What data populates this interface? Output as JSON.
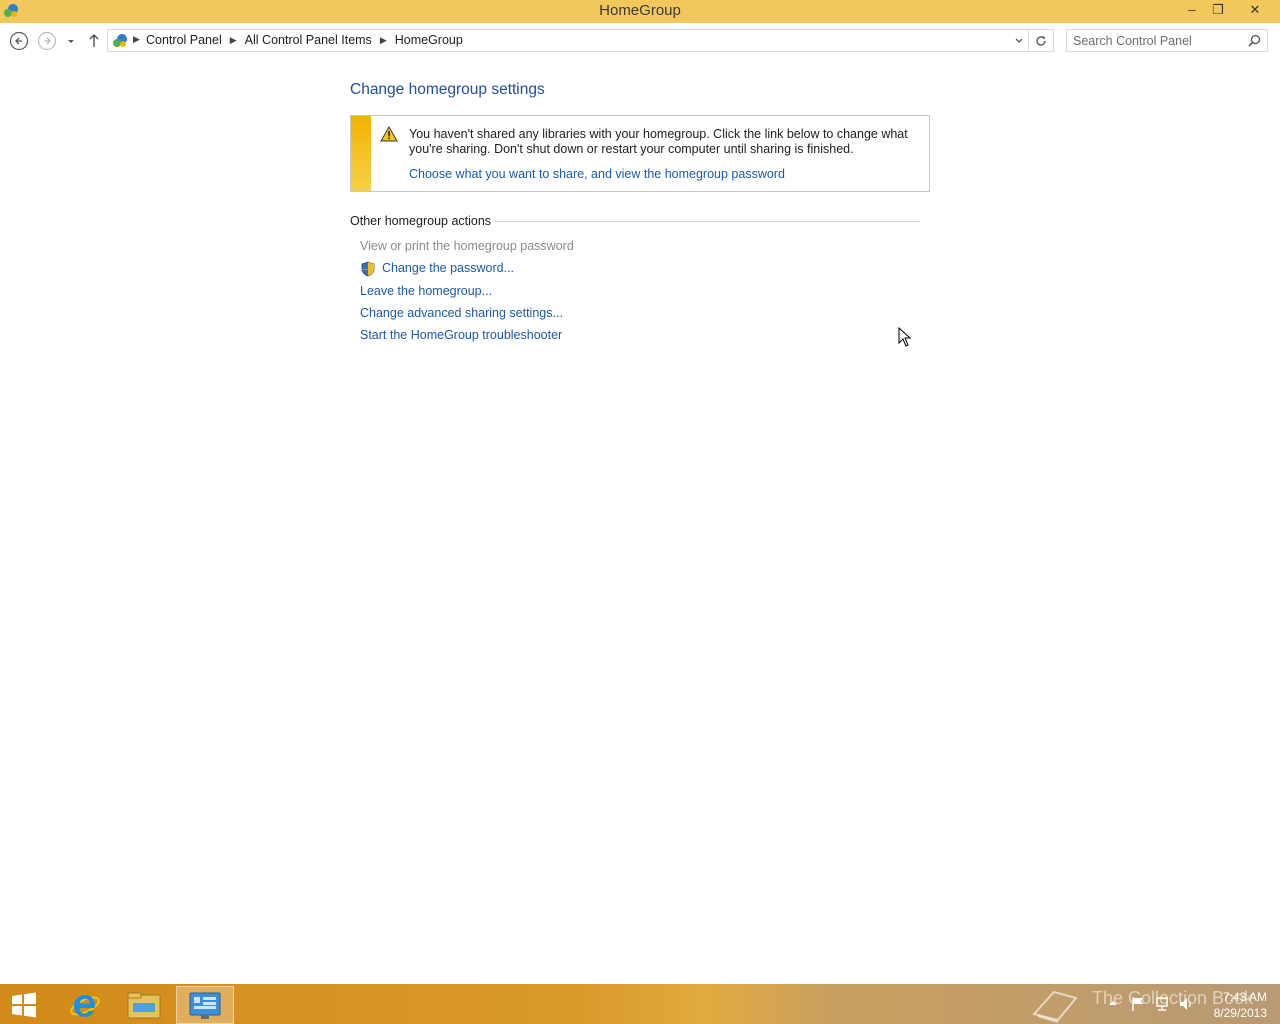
{
  "window": {
    "title": "HomeGroup",
    "minimize_glyph": "–",
    "maximize_glyph": "❐",
    "close_glyph": "✕"
  },
  "nav": {
    "breadcrumbs": [
      "Control Panel",
      "All Control Panel Items",
      "HomeGroup"
    ],
    "search_placeholder": "Search Control Panel"
  },
  "main": {
    "title": "Change homegroup settings",
    "warning": {
      "text": "You haven't shared any libraries with your homegroup. Click the link below to change what you're sharing. Don't shut down or restart your computer until sharing is finished.",
      "link": "Choose what you want to share, and view the homegroup password"
    },
    "other_actions": {
      "heading": "Other homegroup actions",
      "items": [
        {
          "label": "View or print the homegroup password",
          "enabled": false
        },
        {
          "label": "Change the password...",
          "enabled": true,
          "icon": "shield-icon"
        },
        {
          "label": "Leave the homegroup...",
          "enabled": true
        },
        {
          "label": "Change advanced sharing settings...",
          "enabled": true
        },
        {
          "label": "Start the HomeGroup troubleshooter",
          "enabled": true
        }
      ]
    }
  },
  "taskbar": {
    "items": [
      "start-icon",
      "internet-explorer-icon",
      "file-explorer-icon",
      "control-panel-icon"
    ],
    "time": "7:43 AM",
    "date": "8/29/2013",
    "watermark": "The Collection Book"
  },
  "colors": {
    "titlebar": "#f2c75c",
    "link": "#1a5aa8",
    "heading": "#1f4e9e",
    "warning_stripe": "#f0b400"
  }
}
